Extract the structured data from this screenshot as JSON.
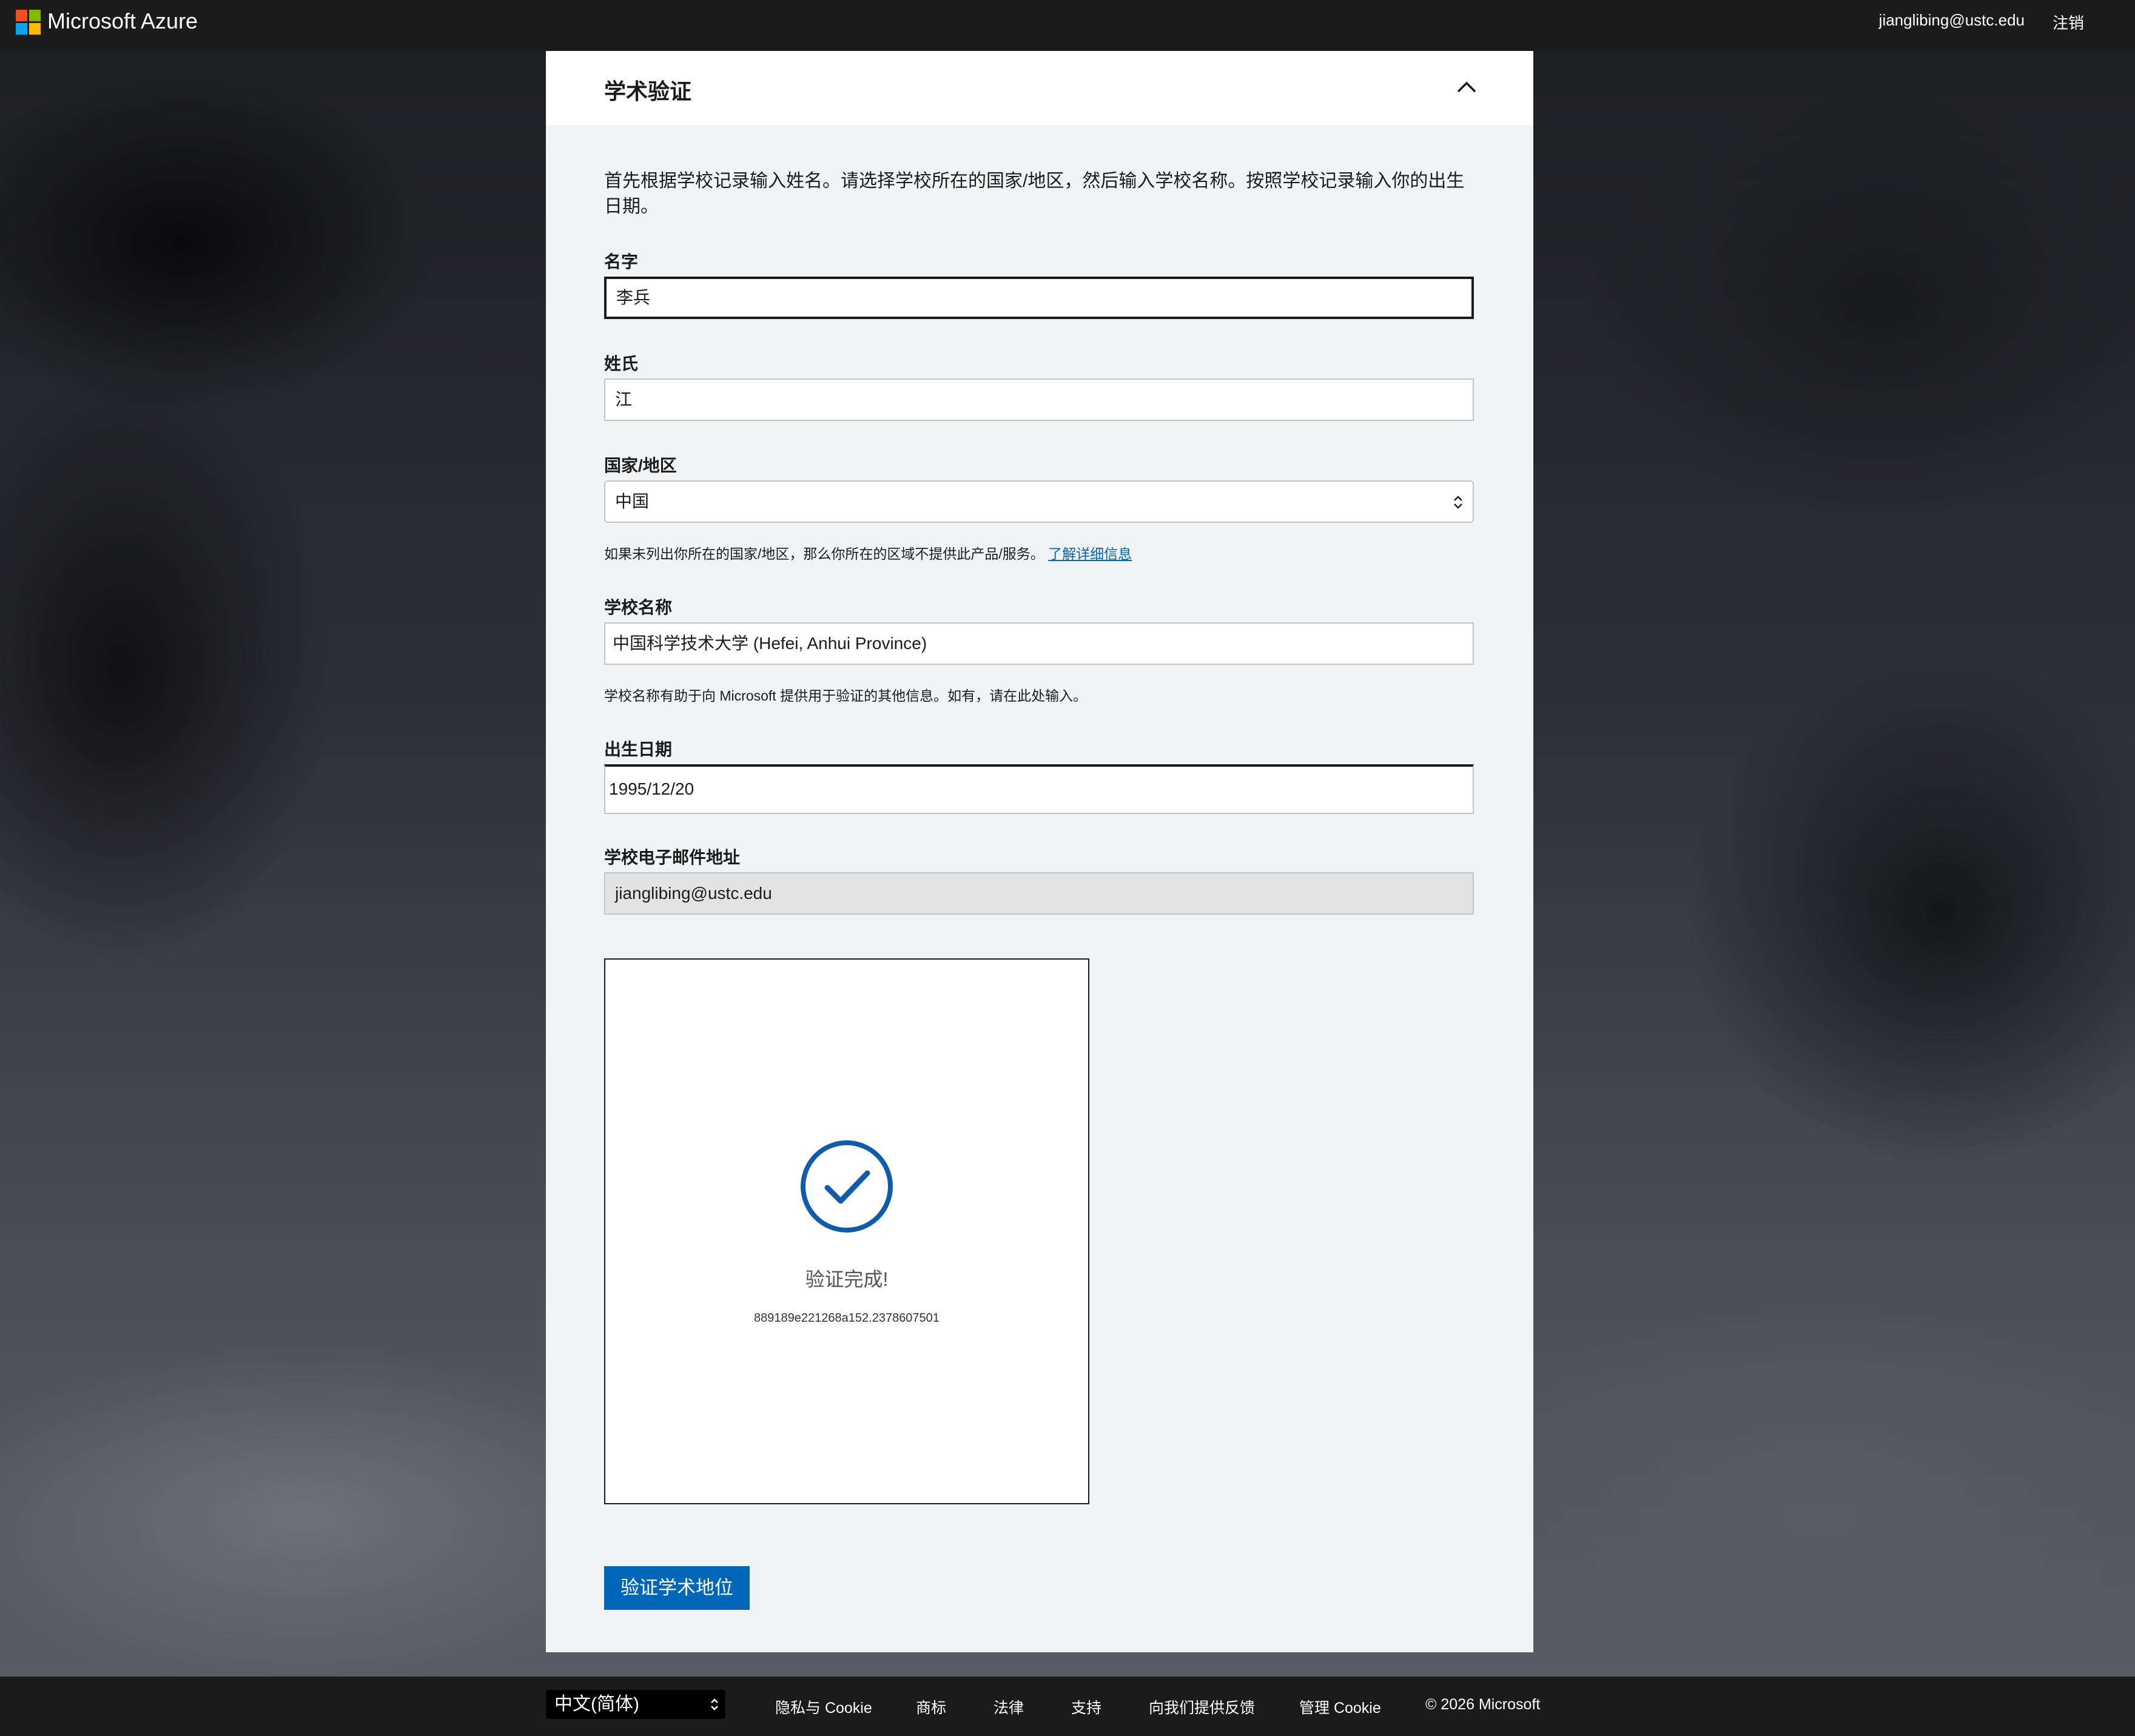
{
  "header": {
    "brand": "Microsoft Azure",
    "user_email": "jianglibing@ustc.edu",
    "signout_label": "注销"
  },
  "section": {
    "title": "学术验证",
    "intro": "首先根据学校记录输入姓名。请选择学校所在的国家/地区，然后输入学校名称。按照学校记录输入你的出生日期。"
  },
  "form": {
    "first_name": {
      "label": "名字",
      "value": "李兵"
    },
    "last_name": {
      "label": "姓氏",
      "value": "江"
    },
    "country": {
      "label": "国家/地区",
      "value": "中国",
      "hint": "如果未列出你所在的国家/地区，那么你所在的区域不提供此产品/服务。",
      "hint_link": "了解详细信息"
    },
    "school": {
      "label": "学校名称",
      "value": "中国科学技术大学 (Hefei, Anhui Province)",
      "hint": "学校名称有助于向 Microsoft 提供用于验证的其他信息。如有，请在此处输入。"
    },
    "birthdate": {
      "label": "出生日期",
      "value": "1995/12/20"
    },
    "school_email": {
      "label": "学校电子邮件地址",
      "value": "jianglibing@ustc.edu"
    }
  },
  "captcha": {
    "status": "验证完成!",
    "token": "889189e221268a152.2378607501",
    "icon": "checkmark-circle-icon",
    "accent": "#0f5cab"
  },
  "submit_label": "验证学术地位",
  "footer": {
    "language": "中文(简体)",
    "links": [
      "隐私与 Cookie",
      "商标",
      "法律",
      "支持",
      "向我们提供反馈",
      "管理 Cookie"
    ],
    "copyright": "© 2026 Microsoft"
  },
  "colors": {
    "accent": "#0067b8",
    "topbar": "#1b1b1b",
    "card_bg": "#f2f3f4"
  }
}
